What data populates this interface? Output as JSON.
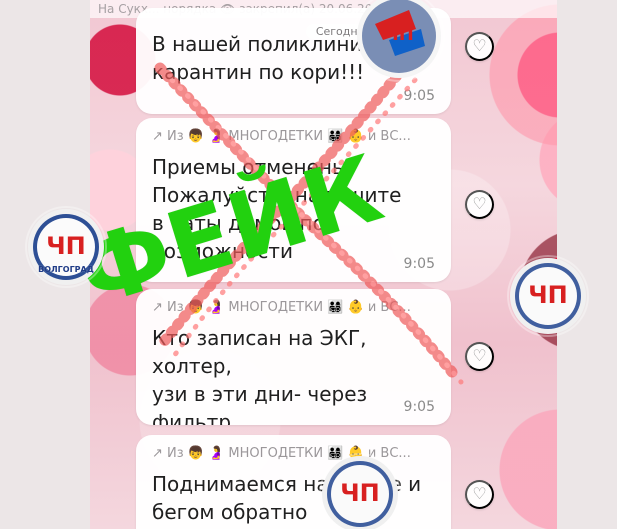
{
  "pinned_bar": {
    "text": "На Сукх... норядка 👁 закрепил(а) 20.06.2023"
  },
  "date_chip": {
    "label": "Сегодня"
  },
  "messages": [
    {
      "forward": "",
      "text": "В нашей поликлинике\nкарантин по кори!!!",
      "time": "9:05"
    },
    {
      "forward": "↗ Из 👦 🤰 МНОГОДЕТКИ 👨‍👩‍👧‍👦 👶 и ВС...",
      "text": "Приемы отменены.\nПожалуйста, напишите\nв чаты домов по\nвозможности",
      "time": "9:05"
    },
    {
      "forward": "↗ Из 👦 🤰 МНОГОДЕТКИ 👨‍👩‍👧‍👦 👶 и ВС...",
      "text": "Кто записан на ЭКГ, холтер,\nузи в эти дни- через фильтр\nна входе пропустят",
      "time": "9:05"
    },
    {
      "forward": "↗ Из 👦 🤰 МНОГОДЕТКИ 👨‍👩‍👧‍👦 👶 и ВС...",
      "text": "Поднимаемся на лифте и\nбегом обратно",
      "time": ""
    }
  ],
  "stamp": {
    "label": "ФЕЙК",
    "color": "#22d10f"
  },
  "logo": {
    "mark": "ЧП",
    "caption": "ВОЛГОГРАД",
    "accent": "#d82020",
    "ring": "#e6e6e6"
  },
  "icons": {
    "like": "heart-outline-icon",
    "forward": "forward-arrow-icon"
  }
}
